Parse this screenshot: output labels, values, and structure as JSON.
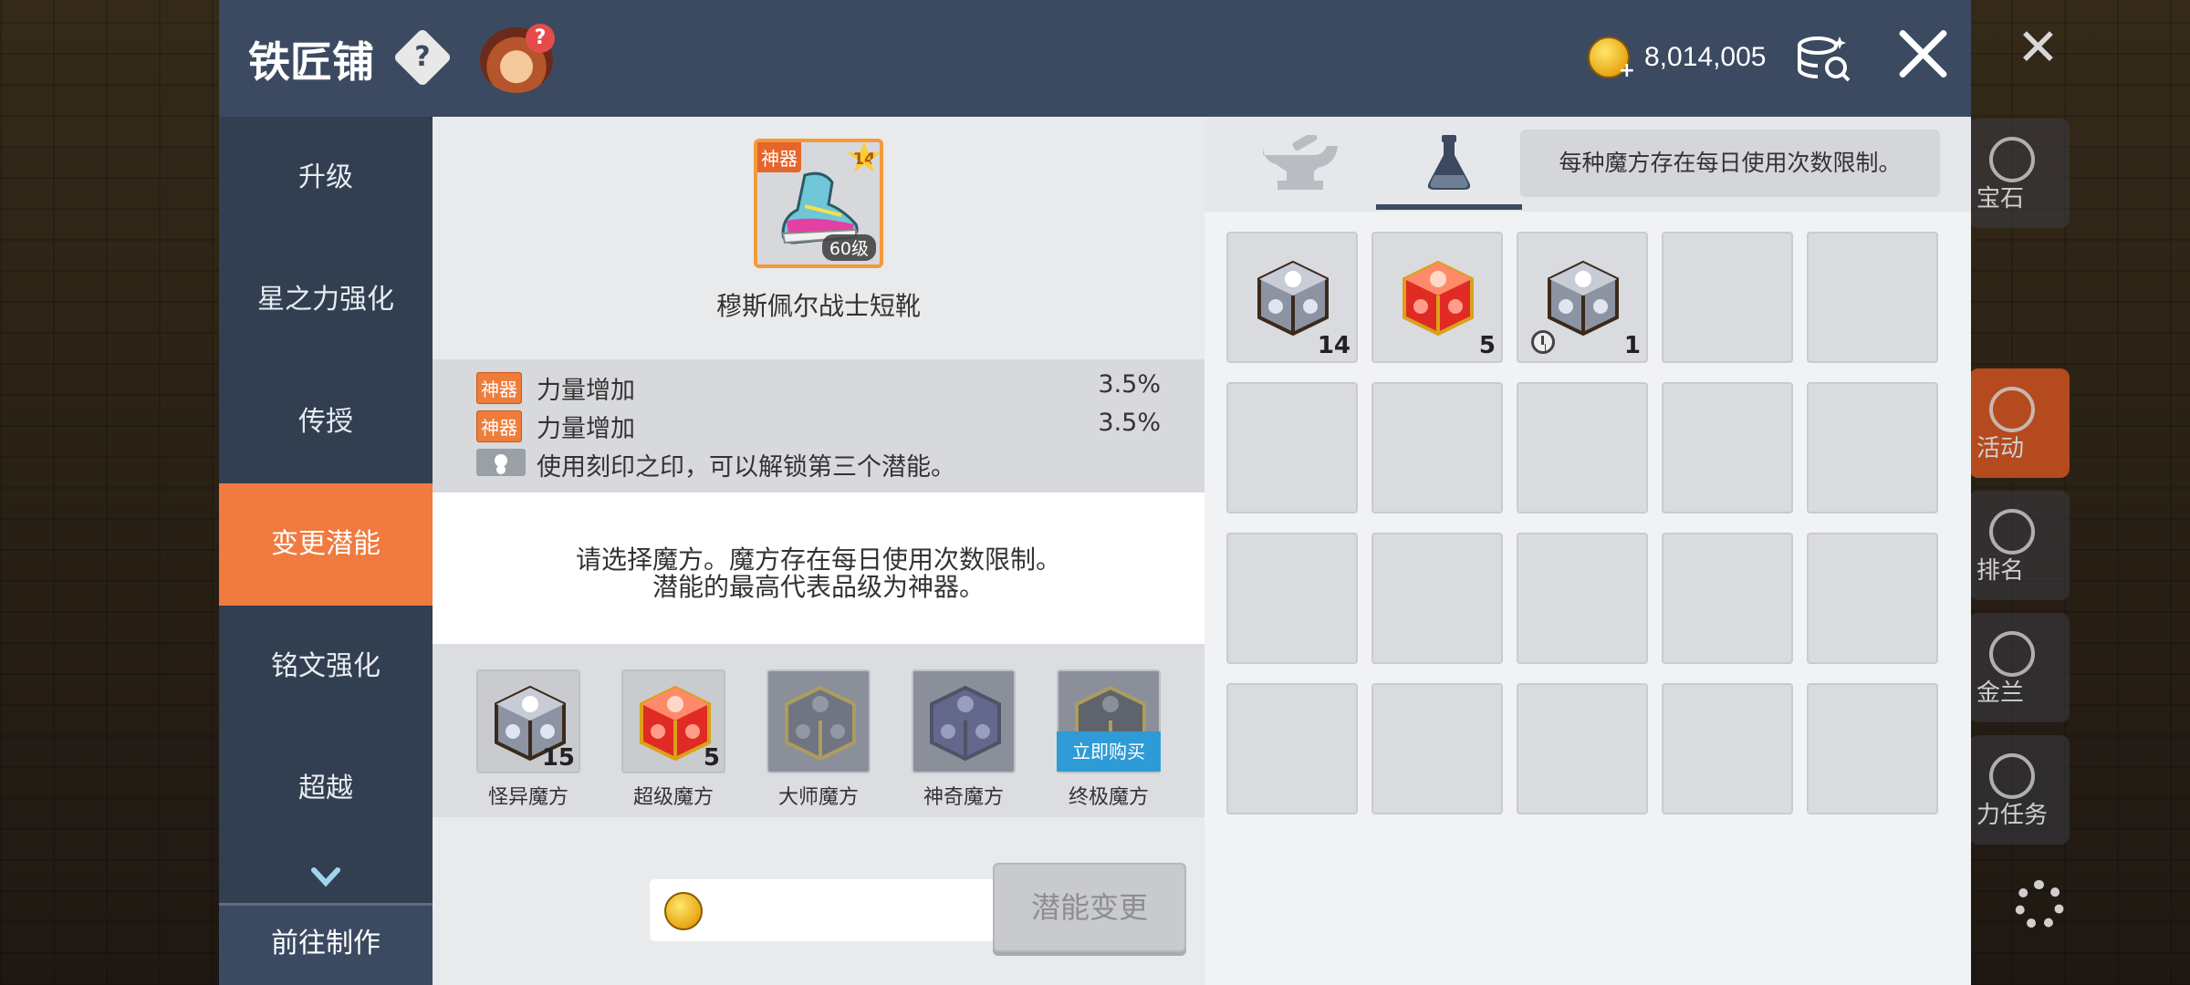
{
  "header": {
    "title": "铁匠铺",
    "meso_amount": "8,014,005"
  },
  "sidebar": {
    "items": [
      {
        "label": "升级"
      },
      {
        "label": "星之力强化"
      },
      {
        "label": "传授"
      },
      {
        "label": "变更潜能",
        "active": true
      },
      {
        "label": "铭文强化"
      },
      {
        "label": "超越"
      }
    ],
    "bottom_button": "前往制作"
  },
  "item": {
    "badge": "神器",
    "stars": "14",
    "level": "60级",
    "name": "穆斯佩尔战士短靴"
  },
  "potentials": [
    {
      "tag": "神器",
      "name": "力量增加",
      "value": "3.5%"
    },
    {
      "tag": "神器",
      "name": "力量增加",
      "value": "3.5%"
    }
  ],
  "lock_hint": "使用刻印之印，可以解锁第三个潜能。",
  "notice": {
    "line1": "请选择魔方。魔方存在每日使用次数限制。",
    "line2": "潜能的最高代表品级为神器。"
  },
  "cubes": [
    {
      "label": "怪异魔方",
      "count": "15",
      "icon": "strange-cube"
    },
    {
      "label": "超级魔方",
      "count": "5",
      "icon": "red-cube"
    },
    {
      "label": "大师魔方",
      "count": "",
      "icon": "master-cube"
    },
    {
      "label": "神奇魔方",
      "count": "",
      "icon": "miracle-cube"
    },
    {
      "label": "终极魔方",
      "count": "",
      "icon": "ultimate-cube",
      "buy_label": "立即购买"
    }
  ],
  "change_button": "潜能变更",
  "right": {
    "tab_note": "每种魔方存在每日使用次数限制。",
    "tabs": [
      {
        "icon": "anvil-icon"
      },
      {
        "icon": "potion-flask-icon",
        "active": true
      }
    ],
    "inventory": [
      {
        "icon": "strange-cube",
        "count": "14"
      },
      {
        "icon": "red-cube",
        "count": "5"
      },
      {
        "icon": "strange-cube",
        "count": "1",
        "timed": true
      }
    ]
  },
  "background": {
    "menu": [
      "宝石",
      "活动",
      "排名",
      "金兰",
      "力任务"
    ]
  },
  "colors": {
    "accent": "#f07a3f",
    "header": "#3b4a61",
    "sidebar": "#323f51",
    "buy": "#2f9bd6"
  }
}
